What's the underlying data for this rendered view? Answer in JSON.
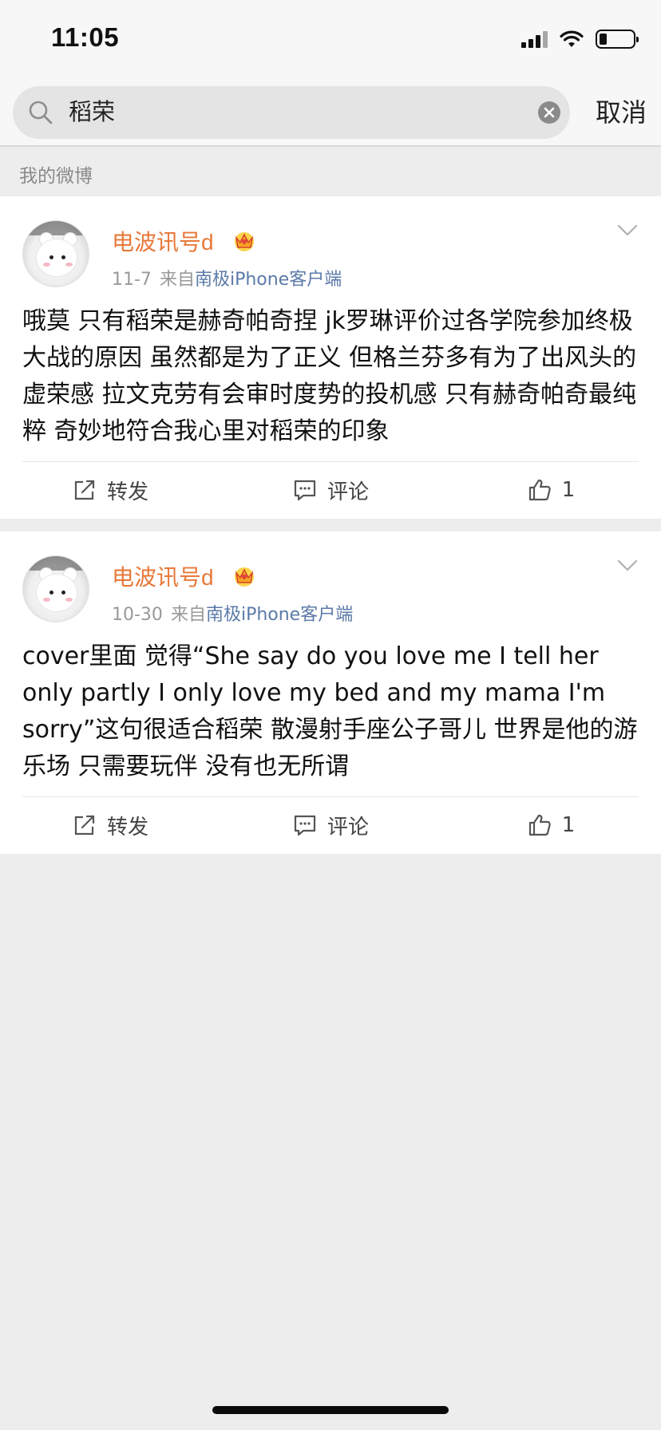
{
  "status_bar": {
    "time": "11:05"
  },
  "search": {
    "query": "稻荣",
    "cancel_label": "取消"
  },
  "section_label": "我的微博",
  "posts": [
    {
      "author": "电波讯号d",
      "date": "11-7",
      "source_prefix": "来自",
      "source": "南极iPhone客户端",
      "text": "哦莫 只有稻荣是赫奇帕奇捏 jk罗琳评价过各学院参加终极大战的原因 虽然都是为了正义 但格兰芬多有为了出风头的虚荣感 拉文克劳有会审时度势的投机感 只有赫奇帕奇最纯粹 奇妙地符合我心里对稻荣的印象",
      "repost_label": "转发",
      "comment_label": "评论",
      "like_count": "1"
    },
    {
      "author": "电波讯号d",
      "date": "10-30",
      "source_prefix": "来自",
      "source": "南极iPhone客户端",
      "text": "cover里面 觉得“She say do you love me I tell her only partly I only love my bed and my mama I'm sorry”这句很适合稻荣 散漫射手座公子哥儿 世界是他的游乐场 只需要玩伴 没有也无所谓",
      "repost_label": "转发",
      "comment_label": "评论",
      "like_count": "1"
    }
  ],
  "colors": {
    "author": "#e8793a",
    "source_link": "#5b7aa8",
    "meta": "#999999",
    "background": "#ededed"
  }
}
